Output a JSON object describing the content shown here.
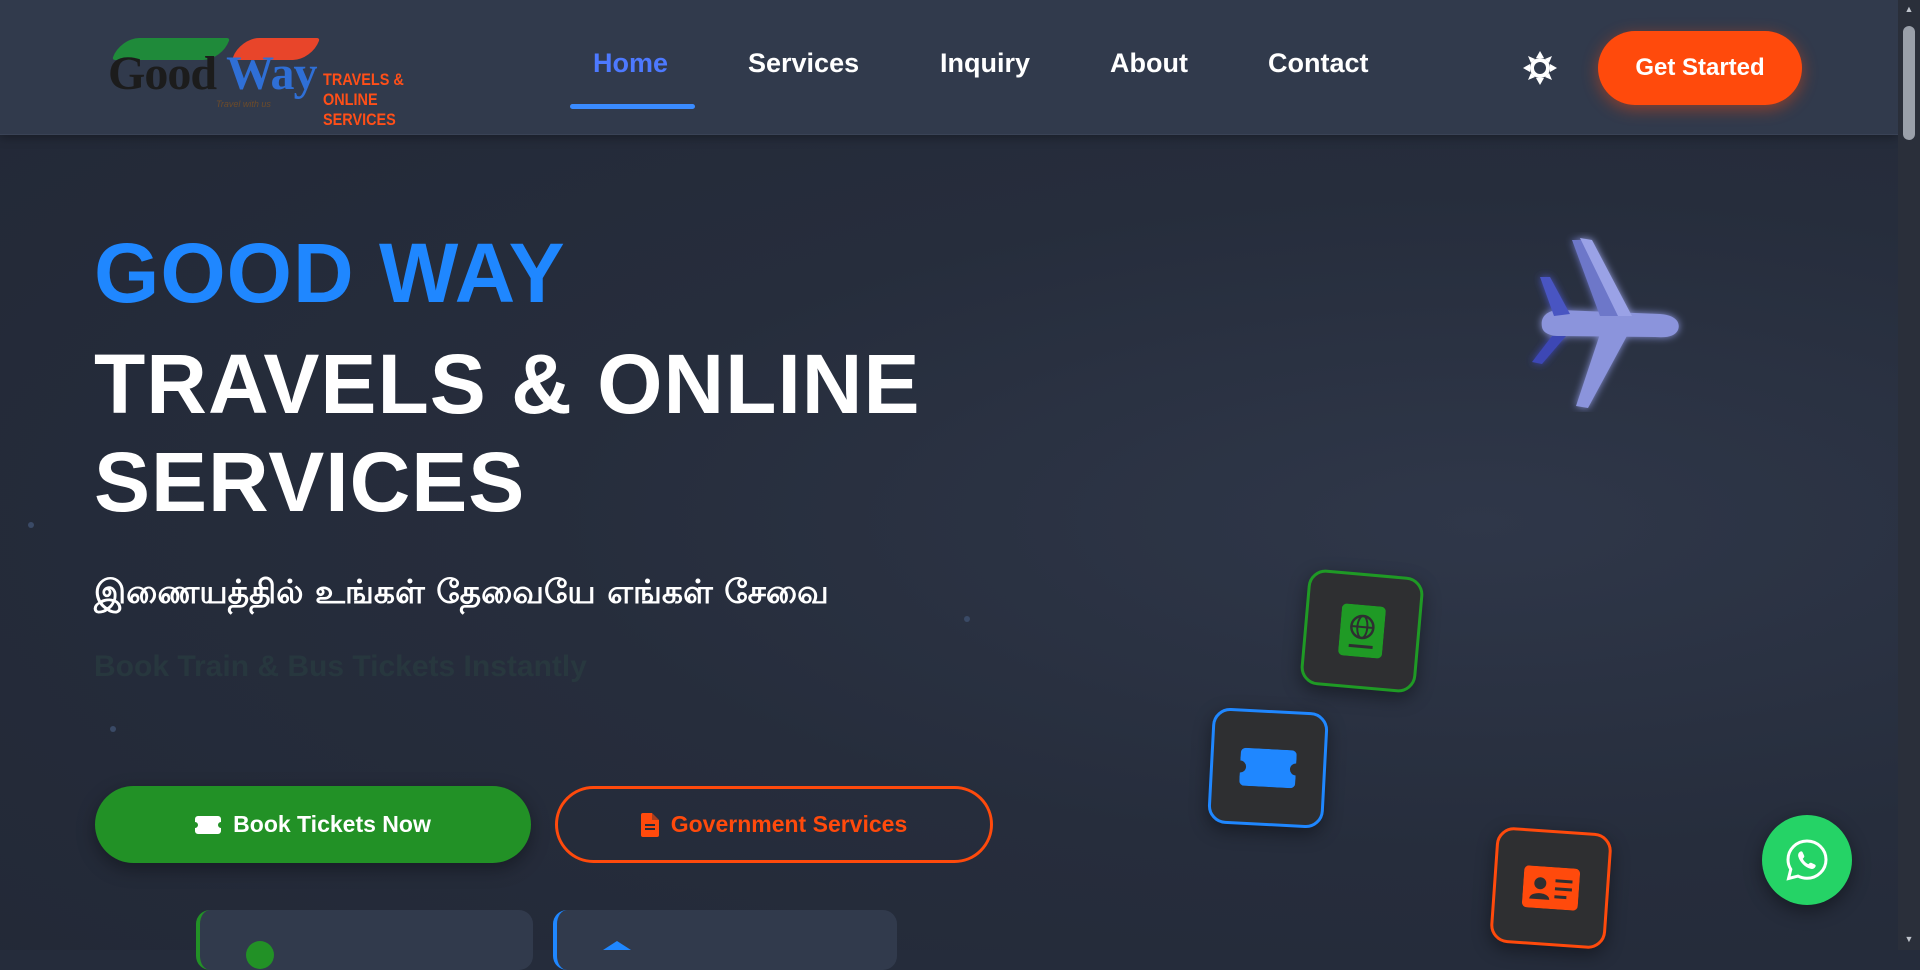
{
  "brand": {
    "logo_word_1": "Good",
    "logo_word_2": "Way",
    "logo_sub_line_1": "TRAVELS &",
    "logo_sub_line_2": "ONLINE SERVICES",
    "logo_tagline": "Travel with us"
  },
  "nav": {
    "items": [
      {
        "label": "Home",
        "active": true
      },
      {
        "label": "Services",
        "active": false
      },
      {
        "label": "Inquiry",
        "active": false
      },
      {
        "label": "About",
        "active": false
      },
      {
        "label": "Contact",
        "active": false
      }
    ],
    "theme_toggle_icon": "sun-icon",
    "cta_label": "Get Started"
  },
  "hero": {
    "title_line_1": "GOOD WAY",
    "title_line_2": "TRAVELS & ONLINE SERVICES",
    "tamil_tagline": "இணையத்தில் உங்கள் தேவையே எங்கள் சேவை",
    "faded_subtitle": "Book Train & Bus Tickets Instantly",
    "book_button_label": "Book Tickets Now",
    "gov_button_label": "Government Services"
  },
  "floating_icons": [
    {
      "icon": "passport-icon",
      "color": "#1f9a25"
    },
    {
      "icon": "ticket-icon",
      "color": "#1f87ff"
    },
    {
      "icon": "id-card-icon",
      "color": "#ff4a0c"
    }
  ],
  "colors": {
    "accent_blue": "#1f87ff",
    "accent_orange": "#ff4a0c",
    "accent_green": "#229126",
    "whatsapp_green": "#25d366",
    "header_bg": "#313a4c",
    "page_bg": "#252c3b"
  }
}
